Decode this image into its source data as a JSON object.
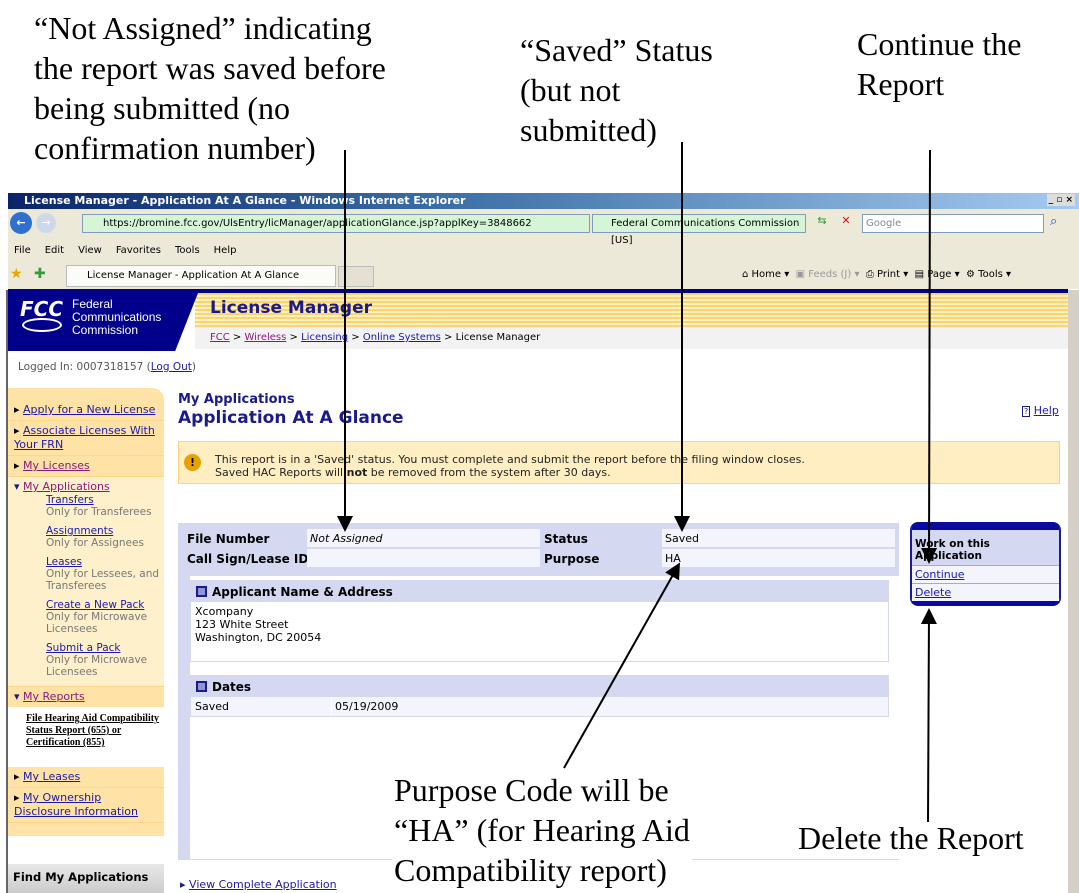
{
  "annotations": {
    "not_assigned": "“Not Assigned” indicating\nthe report was saved before\nbeing submitted (no\nconfirmation number)",
    "saved_status": "“Saved” Status\n(but not\nsubmitted)",
    "continue": "Continue the\nReport",
    "purpose": "Purpose Code will be\n“HA” (for Hearing Aid\nCompatibility report)",
    "delete": "Delete the Report"
  },
  "browser": {
    "title": "License Manager - Application At A Glance - Windows Internet Explorer",
    "url": "https://bromine.fcc.gov/UlsEntry/licManager/applicationGlance.jsp?applKey=3848662",
    "cert": "Federal Communications Commission [US]",
    "search_placeholder": "Google",
    "menu": [
      "File",
      "Edit",
      "View",
      "Favorites",
      "Tools",
      "Help"
    ],
    "tab": "License Manager - Application At A Glance",
    "commands": {
      "home": "Home",
      "feeds": "Feeds (J)",
      "print": "Print",
      "page": "Page",
      "tools": "Tools"
    }
  },
  "header": {
    "logo": "FCC",
    "agency": "Federal\nCommunications\nCommission",
    "app_title": "License Manager",
    "breadcrumb": [
      "FCC",
      "Wireless",
      "Licensing",
      "Online Systems",
      "License Manager"
    ],
    "sep": ">"
  },
  "login": {
    "label": "Logged In: 0007318157 (",
    "logout": "Log Out",
    ")": ")"
  },
  "sidebar": {
    "items": [
      "Apply for a New License",
      "Associate Licenses With Your FRN",
      "My Licenses",
      "My Applications",
      "My Reports",
      "My Leases",
      "My Ownership Disclosure Information"
    ],
    "applications_sub": [
      {
        "link": "Transfers",
        "desc": "Only for Transferees"
      },
      {
        "link": "Assignments",
        "desc": "Only for Assignees"
      },
      {
        "link": "Leases",
        "desc": "Only for Lessees, and Transferees"
      },
      {
        "link": "Create a New Pack",
        "desc": "Only for Microwave Licensees"
      },
      {
        "link": "Submit a Pack",
        "desc": "Only for Microwave Licensees"
      }
    ],
    "reports_sub": "File Hearing Aid Compatibility Status Report (655) or Certification (855)",
    "find": "Find My Applications"
  },
  "main": {
    "section": "My Applications",
    "title": "Application At A Glance",
    "help": "Help",
    "alert_1": "This report is in a 'Saved' status. You must complete and submit the report before the filing window closes.",
    "alert_2a": "Saved HAC Reports will ",
    "alert_2b": "not",
    "alert_2c": " be removed from the system after 30 days.",
    "fields": {
      "file_number_label": "File Number",
      "file_number": "Not Assigned",
      "call_sign_label": "Call Sign/Lease ID",
      "call_sign": "",
      "status_label": "Status",
      "status": "Saved",
      "purpose_label": "Purpose",
      "purpose": "HA"
    },
    "applicant": {
      "title": "Applicant Name & Address",
      "name": "Xcompany",
      "street": "123 White Street",
      "city": "Washington, DC 20054"
    },
    "dates": {
      "title": "Dates",
      "label": "Saved",
      "value": "05/19/2009"
    },
    "work": {
      "title": "Work on this Application",
      "continue": "Continue",
      "delete": "Delete"
    },
    "view_complete": "View Complete Application"
  }
}
